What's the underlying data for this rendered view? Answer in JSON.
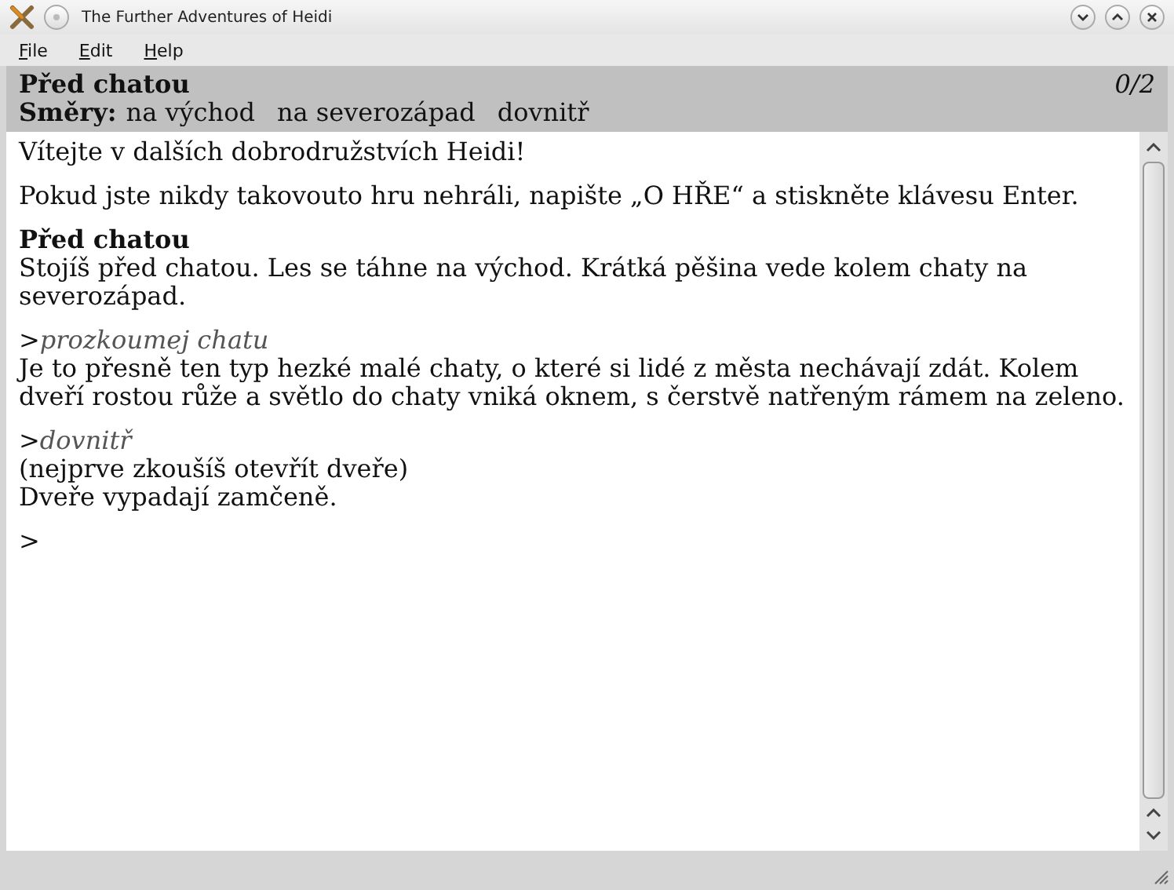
{
  "window": {
    "title": "The Further Adventures of Heidi"
  },
  "menu": [
    {
      "label": "File"
    },
    {
      "label": "Edit"
    },
    {
      "label": "Help"
    }
  ],
  "status_bar": {
    "location": "Před chatou",
    "score": "0/2",
    "exits_label": "Směry:",
    "exits": [
      "na východ",
      "na severozápad",
      "dovnitř"
    ]
  },
  "transcript": [
    {
      "lines": [
        {
          "kind": "text",
          "text": "Vítejte v dalších dobrodružstvích Heidi!"
        }
      ]
    },
    {
      "lines": [
        {
          "kind": "text",
          "text": "Pokud jste nikdy takovouto hru nehráli, napište „O HŘE“ a stiskněte klávesu Enter."
        }
      ]
    },
    {
      "lines": [
        {
          "kind": "heading",
          "text": "Před chatou"
        },
        {
          "kind": "text",
          "text": "Stojíš před chatou. Les se táhne na východ. Krátká pěšina vede kolem chaty na severozápad."
        }
      ]
    },
    {
      "lines": [
        {
          "kind": "command",
          "prompt": ">",
          "text": "prozkoumej chatu"
        },
        {
          "kind": "text",
          "text": "Je to přesně ten typ hezké malé chaty, o které si lidé z města nechávají zdát. Kolem dveří rostou růže a světlo do chaty vniká oknem, s čerstvě natřeným rámem na zeleno."
        }
      ]
    },
    {
      "lines": [
        {
          "kind": "command",
          "prompt": ">",
          "text": "dovnitř"
        },
        {
          "kind": "text",
          "text": "(nejprve zkoušíš otevřít dveře)"
        },
        {
          "kind": "text",
          "text": "Dveře vypadají zamčeně."
        }
      ]
    },
    {
      "lines": [
        {
          "kind": "input",
          "prompt": ">"
        }
      ]
    }
  ]
}
